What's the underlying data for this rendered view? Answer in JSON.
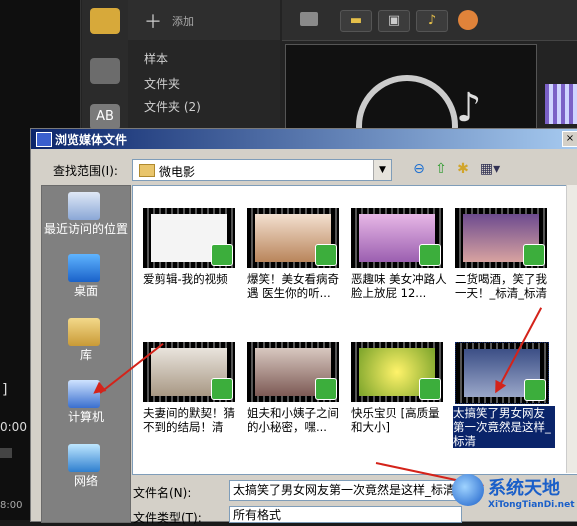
{
  "background_app": {
    "toolbar_add_label": "添加",
    "library_items": [
      "样本",
      "文件夹",
      "文件夹 (2)"
    ],
    "toolbar_buttons": [
      "folder-icon",
      "film-icon",
      "image-icon",
      "music-icon",
      "effect-icon"
    ],
    "left_edge_texts": [
      "]",
      "0:00",
      "0:00",
      "8:00"
    ]
  },
  "dialog": {
    "title": "浏览媒体文件",
    "close_glyph": "×",
    "look_in_label": "查找范围(I):",
    "look_in_value": "微电影",
    "places": [
      "最近访问的位置",
      "桌面",
      "库",
      "计算机",
      "网络"
    ],
    "files": [
      {
        "name": "爱剪辑-我的视频",
        "selected": false
      },
      {
        "name": "爆笑！美女看病奇遇 医生你的听...",
        "selected": false
      },
      {
        "name": "恶趣味 美女冲路人脸上放屁 12...",
        "selected": false
      },
      {
        "name": "二货喝酒，笑了我一天！_标清_标清",
        "selected": false
      },
      {
        "name": "夫妻间的默契！猜不到的结局！清",
        "selected": false
      },
      {
        "name": "姐夫和小姨子之间的小秘密，嘿...",
        "selected": false
      },
      {
        "name": "快乐宝贝 [高质量和大小]",
        "selected": false
      },
      {
        "name": "太搞笑了男女网友第一次竟然是这样_标清",
        "selected": true
      }
    ],
    "file_name_label": "文件名(N):",
    "file_name_value": "太搞笑了男女网友第一次竟然是这样_标清",
    "file_type_label": "文件类型(T):",
    "file_type_value": "所有格式"
  },
  "watermark": {
    "title": "系统天地",
    "subtitle": "XiTongTianDi.net"
  },
  "colors": {
    "title_bar": "#0a246a",
    "selection": "#0a246a",
    "badge_green": "#3cae3c",
    "arrow_red": "#d4231a",
    "watermark_blue": "#1a5fc9"
  }
}
